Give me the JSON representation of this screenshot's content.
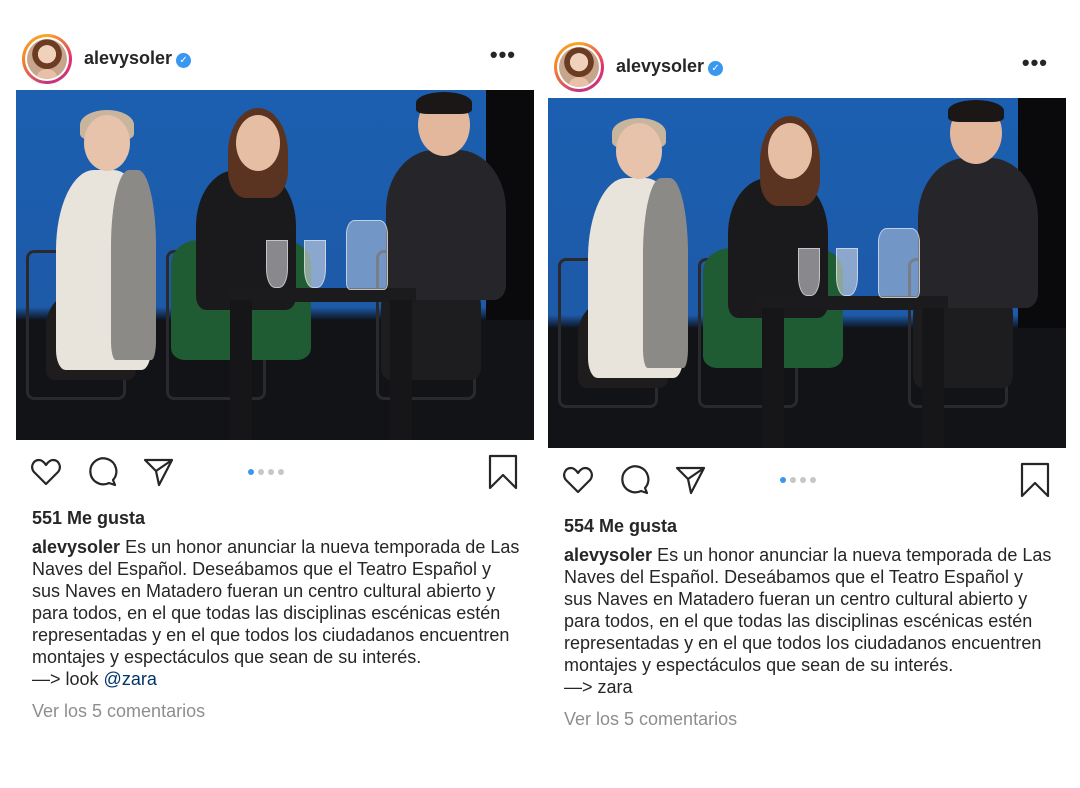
{
  "colors": {
    "accent": "#3897f0",
    "text": "#262626",
    "muted": "#8e8e8e",
    "mention": "#003569"
  },
  "posts": [
    {
      "username": "alevysoler",
      "verified": true,
      "more_label": "•••",
      "likes": "551 Me gusta",
      "caption_user": "alevysoler",
      "caption_text": " Es un honor anunciar la nueva temporada de Las Naves del Español. Deseábamos que el Teatro Español y sus Naves en Matadero fueran un centro cultural abierto y para todos, en el que todas las disciplinas escénicas estén representadas y en el que todos los ciudadanos encuentren montajes y espectáculos que sean de su interés.",
      "arrow_prefix": "—> look ",
      "arrow_mention": "@zara",
      "comments_link": "Ver los 5 comentarios",
      "carousel_total": 4,
      "carousel_active": 1
    },
    {
      "username": "alevysoler",
      "verified": true,
      "more_label": "•••",
      "likes": "554 Me gusta",
      "caption_user": "alevysoler",
      "caption_text": " Es un honor anunciar la nueva temporada de Las Naves del Español. Deseábamos que el Teatro Español y sus Naves en Matadero fueran un centro cultural abierto y para todos, en el que todas las disciplinas escénicas estén representadas y en el que todos los ciudadanos encuentren montajes y espectáculos que sean de su interés.",
      "arrow_prefix": "—> zara",
      "arrow_mention": "",
      "comments_link": "Ver los 5 comentarios",
      "carousel_total": 4,
      "carousel_active": 1
    }
  ],
  "icons": [
    "heart-icon",
    "comment-icon",
    "share-icon",
    "bookmark-icon",
    "verified-badge-icon",
    "more-options-icon"
  ]
}
